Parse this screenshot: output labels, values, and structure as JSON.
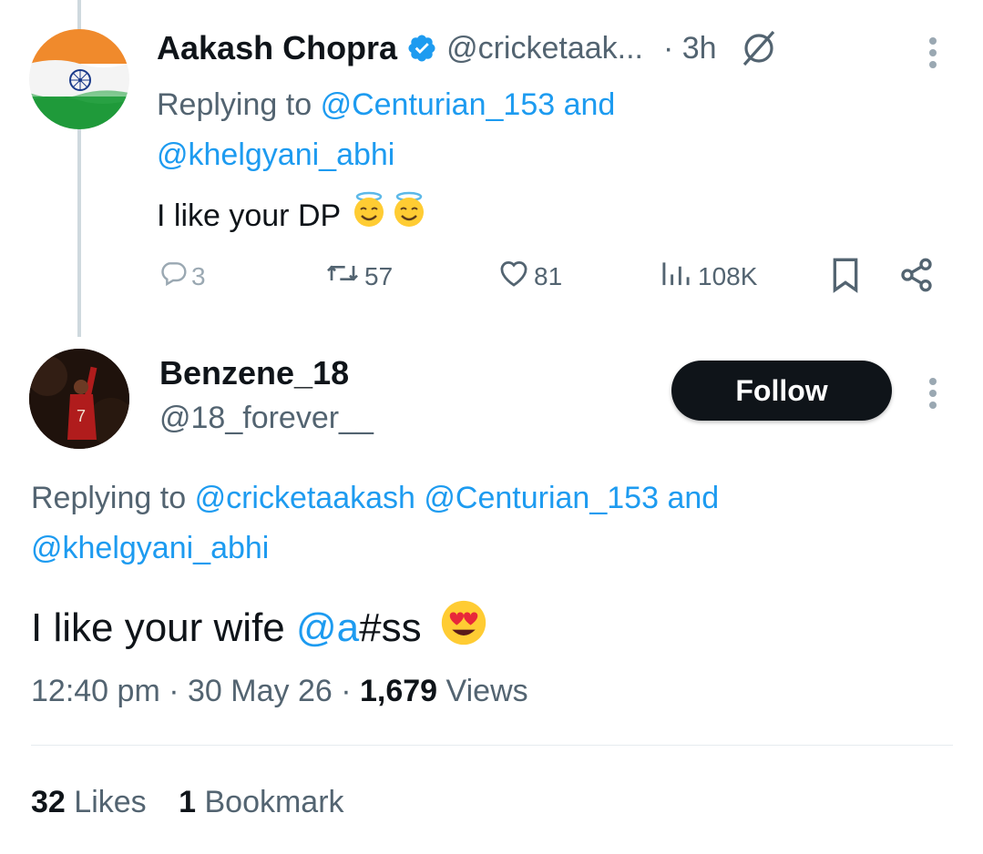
{
  "reply_parent": {
    "author_name": "Aakash Chopra",
    "handle": "@cricketaak...",
    "time": "· 3h",
    "replying_prefix": "Replying to",
    "reply_mention_1": "@Centurian_153",
    "reply_and": "and",
    "reply_mention_2": "@khelgyani_abhi",
    "text": "I like your DP",
    "stats": {
      "replies": "3",
      "reposts": "57",
      "likes": "81",
      "views": "108K"
    }
  },
  "main_tweet": {
    "author_name": "Benzene_18",
    "handle": "@18_forever__",
    "follow_label": "Follow",
    "replying_prefix": "Replying to",
    "mention_1": "@cricketaakash",
    "mention_2": "@Centurian_153",
    "and_text": "and",
    "mention_3": "@khelgyani_abhi",
    "text_before": "I like your wife",
    "text_mention": "@a",
    "text_after": "#ss",
    "time": "12:40 pm",
    "date": "30 May 26",
    "views_count": "1,679",
    "views_label": "Views",
    "likes_count": "32",
    "likes_label": "Likes",
    "bookmarks_count": "1",
    "bookmarks_label": "Bookmark"
  },
  "colors": {
    "accent": "#1d9bf0",
    "text": "#0f1419",
    "muted": "#536471",
    "divider": "#eff3f4"
  }
}
